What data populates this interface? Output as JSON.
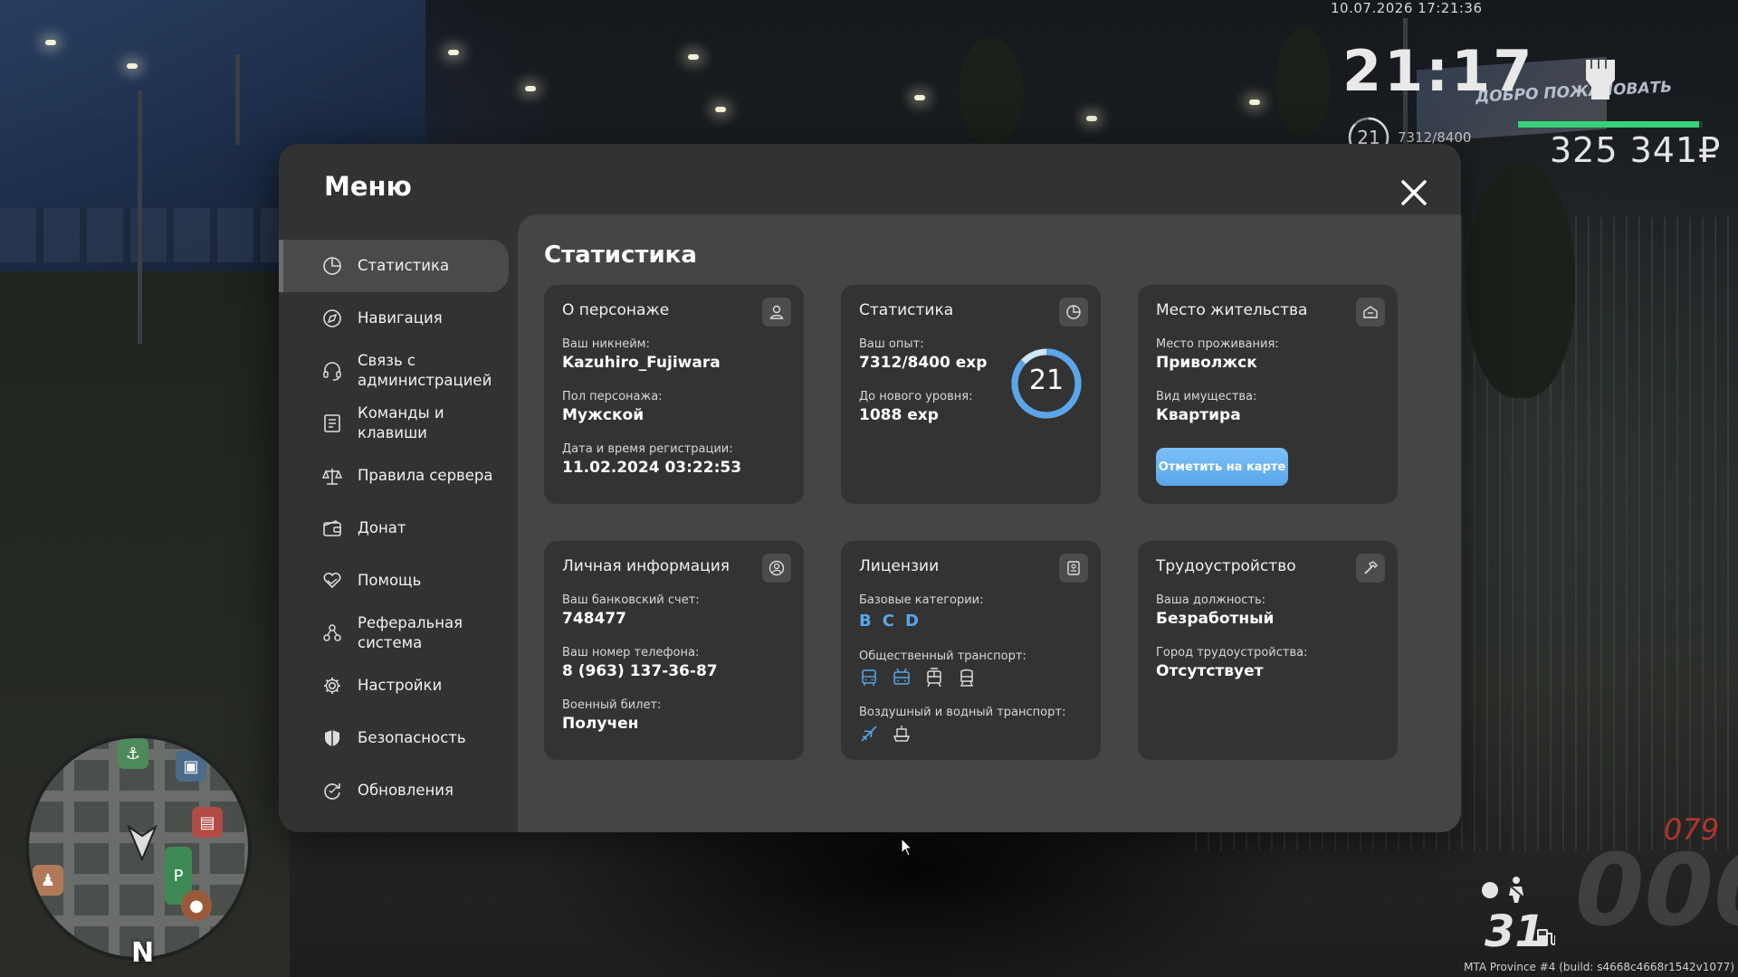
{
  "hud": {
    "datetime": "10.07.2026 17:21:36",
    "clock": "21:17",
    "level": "21",
    "exp": "7312/8400",
    "money": "325 341₽",
    "health_fraction": 0.98,
    "odometer": "079",
    "speed_ghost": "000",
    "fuel": "31",
    "build": "MTA Province #4 (build: s4668c4668r1542v1077)",
    "banner": "ДОБРО ПОЖАЛОВАТЬ",
    "compass": "N"
  },
  "menu": {
    "title": "Меню",
    "nav": [
      {
        "label": "Статистика",
        "icon": "pie-chart-icon",
        "active": true
      },
      {
        "label": "Навигация",
        "icon": "compass-icon"
      },
      {
        "label": "Связь с администрацией",
        "icon": "headset-icon"
      },
      {
        "label": "Команды и клавиши",
        "icon": "document-list-icon"
      },
      {
        "label": "Правила сервера",
        "icon": "scales-icon"
      },
      {
        "label": "Донат",
        "icon": "wallet-icon"
      },
      {
        "label": "Помощь",
        "icon": "heart-hand-icon"
      },
      {
        "label": "Реферальная система",
        "icon": "referral-icon"
      },
      {
        "label": "Настройки",
        "icon": "gear-icon"
      },
      {
        "label": "Безопасность",
        "icon": "shield-icon"
      },
      {
        "label": "Обновления",
        "icon": "refresh-icon"
      }
    ]
  },
  "content": {
    "title": "Статистика",
    "character": {
      "title": "О персонаже",
      "nickname_label": "Ваш никнейм:",
      "nickname": "Kazuhiro_Fujiwara",
      "gender_label": "Пол персонажа:",
      "gender": "Мужской",
      "reg_label": "Дата и время регистрации:",
      "reg": "11.02.2024 03:22:53"
    },
    "stats": {
      "title": "Статистика",
      "exp_label": "Ваш опыт:",
      "exp": "7312/8400 exp",
      "next_label": "До нового уровня:",
      "next": "1088 exp",
      "level": "21",
      "progress": 0.87
    },
    "residence": {
      "title": "Место жительства",
      "place_label": "Место проживания:",
      "place": "Приволжск",
      "property_label": "Вид имущества:",
      "property": "Квартира",
      "button": "Отметить на карте"
    },
    "personal": {
      "title": "Личная информация",
      "bank_label": "Ваш банковский счет:",
      "bank": "748477",
      "phone_label": "Ваш номер телефона:",
      "phone": "8 (963) 137-36-87",
      "military_label": "Военный билет:",
      "military": "Получен"
    },
    "licenses": {
      "title": "Лицензии",
      "base_label": "Базовые категории:",
      "categories": [
        "B",
        "C",
        "D"
      ],
      "public_label": "Общественный транспорт:",
      "public_icons": [
        "bus-icon",
        "trolleybus-icon",
        "tram-icon",
        "train-icon"
      ],
      "air_label": "Воздушный и водный транспорт:",
      "air_icons": [
        "plane-icon",
        "boat-icon"
      ]
    },
    "employment": {
      "title": "Трудоустройство",
      "position_label": "Ваша должность:",
      "position": "Безработный",
      "city_label": "Город трудоустройства:",
      "city": "Отсутствует"
    }
  },
  "colors": {
    "accent": "#5aa6ea",
    "window": "#323232",
    "content": "#454545",
    "card": "#333333"
  }
}
